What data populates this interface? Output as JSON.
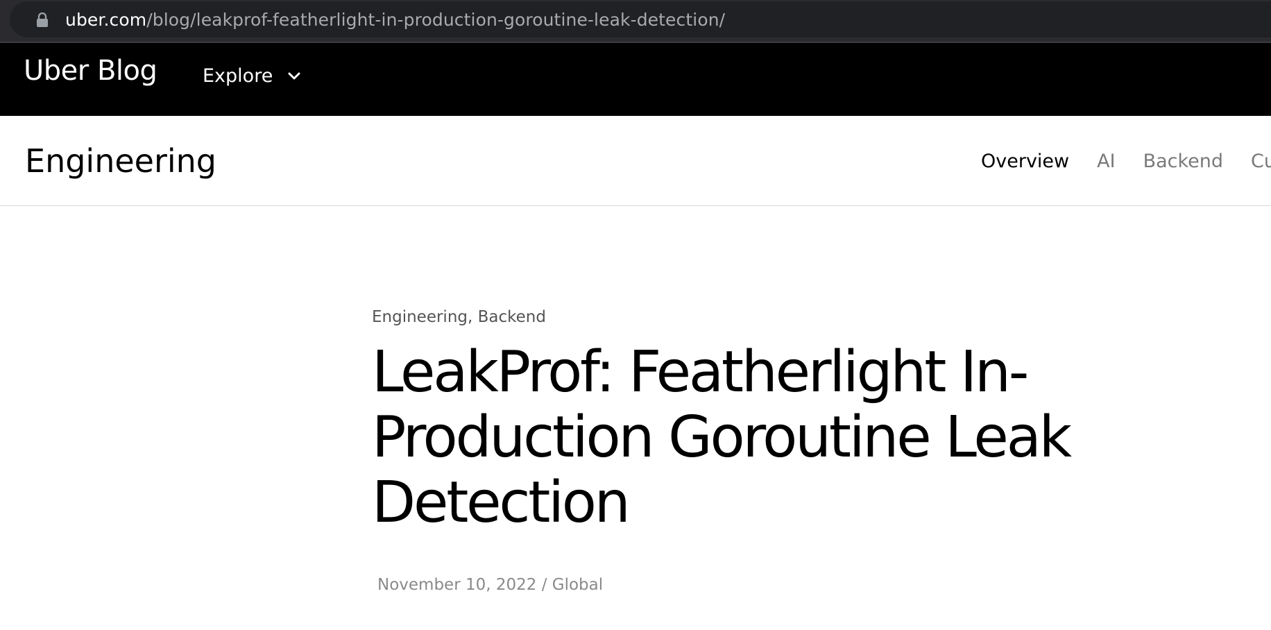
{
  "browser": {
    "url_host": "uber.com",
    "url_path": "/blog/leakprof-featherlight-in-production-goroutine-leak-detection/"
  },
  "header": {
    "logo": "Uber Blog",
    "explore_label": "Explore"
  },
  "section_nav": {
    "title": "Engineering",
    "tabs": [
      {
        "label": "Overview",
        "active": true
      },
      {
        "label": "AI",
        "active": false
      },
      {
        "label": "Backend",
        "active": false
      },
      {
        "label": "Cul",
        "active": false
      }
    ]
  },
  "article": {
    "categories": [
      "Engineering",
      "Backend"
    ],
    "category_separator": ", ",
    "title": "LeakProf: Featherlight In-Production Goroutine Leak Detection",
    "date": "November 10, 2022",
    "meta_separator": " / ",
    "region": "Global"
  },
  "icons": {
    "lock": "lock-icon",
    "explore_chevron": "chevron-down-icon"
  },
  "colors": {
    "browser_bar": "#202124",
    "header_bg": "#000000",
    "inactive_tab": "#7a7a7a",
    "meta_text": "#8a8a8a"
  }
}
